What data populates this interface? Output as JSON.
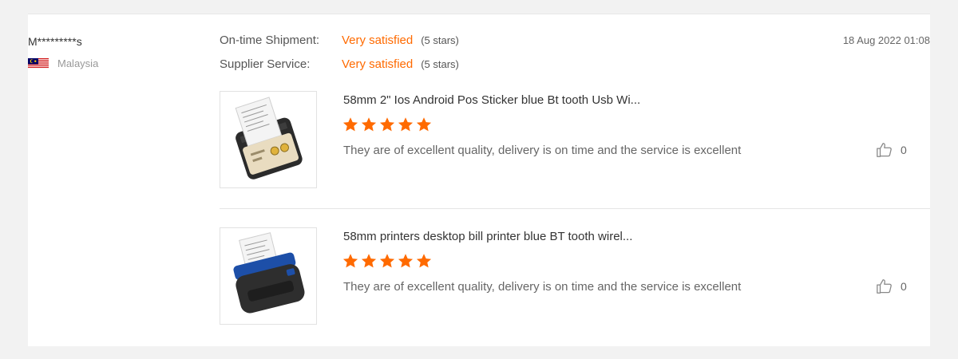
{
  "review": {
    "reviewer_name": "M*********s",
    "country": "Malaysia",
    "flag_icon": "malaysia-flag-icon",
    "date": "18 Aug 2022 01:08",
    "ratings": [
      {
        "label": "On-time Shipment:",
        "value": "Very satisfied",
        "note": "(5 stars)"
      },
      {
        "label": "Supplier Service:",
        "value": "Very satisfied",
        "note": "(5 stars)"
      }
    ],
    "products": [
      {
        "title": "58mm 2\" Ios Android Pos Sticker blue Bt tooth Usb Wi...",
        "stars": 5,
        "text": "They are of excellent quality, delivery is on time and the service is excellent",
        "likes": "0",
        "image_icon": "thermal-printer-image"
      },
      {
        "title": "58mm printers desktop bill printer blue BT tooth wirel...",
        "stars": 5,
        "text": "They are of excellent quality, delivery is on time and the service is excellent",
        "likes": "0",
        "image_icon": "blue-thermal-printer-image"
      }
    ]
  },
  "colors": {
    "accent": "#ff6a00",
    "star": "#ff6a00",
    "muted": "#999999"
  }
}
